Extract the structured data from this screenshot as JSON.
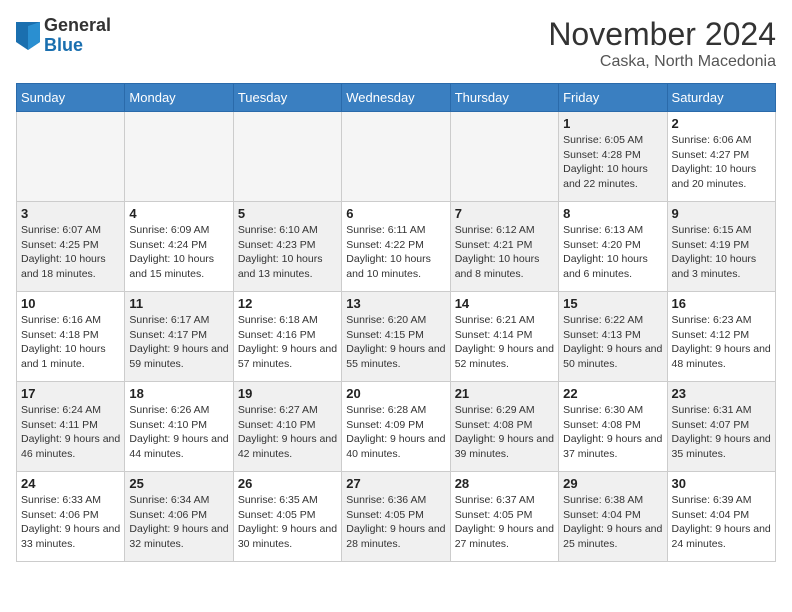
{
  "logo": {
    "general": "General",
    "blue": "Blue"
  },
  "header": {
    "month": "November 2024",
    "location": "Caska, North Macedonia"
  },
  "weekdays": [
    "Sunday",
    "Monday",
    "Tuesday",
    "Wednesday",
    "Thursday",
    "Friday",
    "Saturday"
  ],
  "weeks": [
    [
      {
        "day": "",
        "info": "",
        "empty": true
      },
      {
        "day": "",
        "info": "",
        "empty": true
      },
      {
        "day": "",
        "info": "",
        "empty": true
      },
      {
        "day": "",
        "info": "",
        "empty": true
      },
      {
        "day": "",
        "info": "",
        "empty": true
      },
      {
        "day": "1",
        "info": "Sunrise: 6:05 AM\nSunset: 4:28 PM\nDaylight: 10 hours and 22 minutes.",
        "shaded": true
      },
      {
        "day": "2",
        "info": "Sunrise: 6:06 AM\nSunset: 4:27 PM\nDaylight: 10 hours and 20 minutes.",
        "shaded": false
      }
    ],
    [
      {
        "day": "3",
        "info": "Sunrise: 6:07 AM\nSunset: 4:25 PM\nDaylight: 10 hours and 18 minutes.",
        "shaded": true
      },
      {
        "day": "4",
        "info": "Sunrise: 6:09 AM\nSunset: 4:24 PM\nDaylight: 10 hours and 15 minutes.",
        "shaded": false
      },
      {
        "day": "5",
        "info": "Sunrise: 6:10 AM\nSunset: 4:23 PM\nDaylight: 10 hours and 13 minutes.",
        "shaded": true
      },
      {
        "day": "6",
        "info": "Sunrise: 6:11 AM\nSunset: 4:22 PM\nDaylight: 10 hours and 10 minutes.",
        "shaded": false
      },
      {
        "day": "7",
        "info": "Sunrise: 6:12 AM\nSunset: 4:21 PM\nDaylight: 10 hours and 8 minutes.",
        "shaded": true
      },
      {
        "day": "8",
        "info": "Sunrise: 6:13 AM\nSunset: 4:20 PM\nDaylight: 10 hours and 6 minutes.",
        "shaded": false
      },
      {
        "day": "9",
        "info": "Sunrise: 6:15 AM\nSunset: 4:19 PM\nDaylight: 10 hours and 3 minutes.",
        "shaded": true
      }
    ],
    [
      {
        "day": "10",
        "info": "Sunrise: 6:16 AM\nSunset: 4:18 PM\nDaylight: 10 hours and 1 minute.",
        "shaded": false
      },
      {
        "day": "11",
        "info": "Sunrise: 6:17 AM\nSunset: 4:17 PM\nDaylight: 9 hours and 59 minutes.",
        "shaded": true
      },
      {
        "day": "12",
        "info": "Sunrise: 6:18 AM\nSunset: 4:16 PM\nDaylight: 9 hours and 57 minutes.",
        "shaded": false
      },
      {
        "day": "13",
        "info": "Sunrise: 6:20 AM\nSunset: 4:15 PM\nDaylight: 9 hours and 55 minutes.",
        "shaded": true
      },
      {
        "day": "14",
        "info": "Sunrise: 6:21 AM\nSunset: 4:14 PM\nDaylight: 9 hours and 52 minutes.",
        "shaded": false
      },
      {
        "day": "15",
        "info": "Sunrise: 6:22 AM\nSunset: 4:13 PM\nDaylight: 9 hours and 50 minutes.",
        "shaded": true
      },
      {
        "day": "16",
        "info": "Sunrise: 6:23 AM\nSunset: 4:12 PM\nDaylight: 9 hours and 48 minutes.",
        "shaded": false
      }
    ],
    [
      {
        "day": "17",
        "info": "Sunrise: 6:24 AM\nSunset: 4:11 PM\nDaylight: 9 hours and 46 minutes.",
        "shaded": true
      },
      {
        "day": "18",
        "info": "Sunrise: 6:26 AM\nSunset: 4:10 PM\nDaylight: 9 hours and 44 minutes.",
        "shaded": false
      },
      {
        "day": "19",
        "info": "Sunrise: 6:27 AM\nSunset: 4:10 PM\nDaylight: 9 hours and 42 minutes.",
        "shaded": true
      },
      {
        "day": "20",
        "info": "Sunrise: 6:28 AM\nSunset: 4:09 PM\nDaylight: 9 hours and 40 minutes.",
        "shaded": false
      },
      {
        "day": "21",
        "info": "Sunrise: 6:29 AM\nSunset: 4:08 PM\nDaylight: 9 hours and 39 minutes.",
        "shaded": true
      },
      {
        "day": "22",
        "info": "Sunrise: 6:30 AM\nSunset: 4:08 PM\nDaylight: 9 hours and 37 minutes.",
        "shaded": false
      },
      {
        "day": "23",
        "info": "Sunrise: 6:31 AM\nSunset: 4:07 PM\nDaylight: 9 hours and 35 minutes.",
        "shaded": true
      }
    ],
    [
      {
        "day": "24",
        "info": "Sunrise: 6:33 AM\nSunset: 4:06 PM\nDaylight: 9 hours and 33 minutes.",
        "shaded": false
      },
      {
        "day": "25",
        "info": "Sunrise: 6:34 AM\nSunset: 4:06 PM\nDaylight: 9 hours and 32 minutes.",
        "shaded": true
      },
      {
        "day": "26",
        "info": "Sunrise: 6:35 AM\nSunset: 4:05 PM\nDaylight: 9 hours and 30 minutes.",
        "shaded": false
      },
      {
        "day": "27",
        "info": "Sunrise: 6:36 AM\nSunset: 4:05 PM\nDaylight: 9 hours and 28 minutes.",
        "shaded": true
      },
      {
        "day": "28",
        "info": "Sunrise: 6:37 AM\nSunset: 4:05 PM\nDaylight: 9 hours and 27 minutes.",
        "shaded": false
      },
      {
        "day": "29",
        "info": "Sunrise: 6:38 AM\nSunset: 4:04 PM\nDaylight: 9 hours and 25 minutes.",
        "shaded": true
      },
      {
        "day": "30",
        "info": "Sunrise: 6:39 AM\nSunset: 4:04 PM\nDaylight: 9 hours and 24 minutes.",
        "shaded": false
      }
    ]
  ]
}
